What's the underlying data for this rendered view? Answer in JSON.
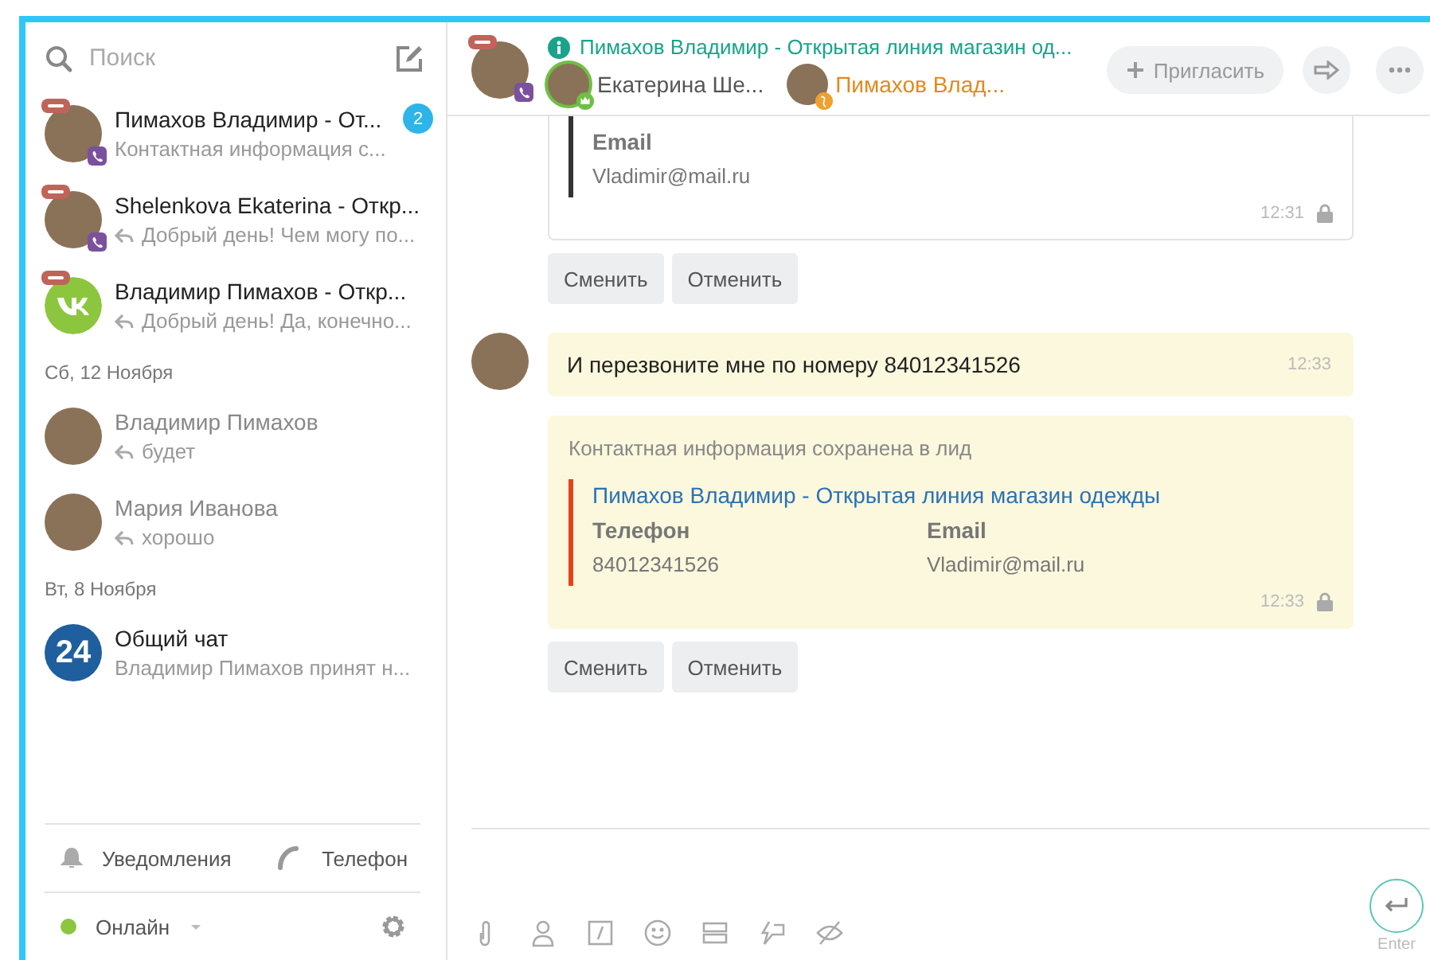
{
  "sidebar": {
    "search": {
      "placeholder": "Поиск"
    },
    "items": [
      {
        "kind": "chat",
        "avatar": {
          "kind": "photo"
        },
        "crm": true,
        "viber": true,
        "name": "Пимахов Владимир - От...",
        "preview": "Контактная информация с...",
        "reply": false,
        "dimmed": false,
        "unread": "2"
      },
      {
        "kind": "chat",
        "avatar": {
          "kind": "photo"
        },
        "crm": true,
        "viber": true,
        "name": "Shelenkova Ekaterina - Откр...",
        "preview": "Добрый день! Чем могу по...",
        "reply": true,
        "dimmed": false
      },
      {
        "kind": "chat",
        "avatar": {
          "kind": "vk"
        },
        "crm": true,
        "viber": false,
        "name": "Владимир Пимахов - Откр...",
        "preview": "Добрый день! Да, конечно...",
        "reply": true,
        "dimmed": false
      },
      {
        "kind": "date",
        "label": "Сб, 12 Ноября"
      },
      {
        "kind": "chat",
        "avatar": {
          "kind": "photo"
        },
        "crm": false,
        "viber": false,
        "name": "Владимир Пимахов",
        "preview": "будет",
        "reply": true,
        "dimmed": true
      },
      {
        "kind": "chat",
        "avatar": {
          "kind": "photo"
        },
        "crm": false,
        "viber": false,
        "name": "Мария Иванова",
        "preview": "хорошо",
        "reply": true,
        "dimmed": true
      },
      {
        "kind": "date",
        "label": "Вт, 8 Ноября"
      },
      {
        "kind": "chat",
        "avatar": {
          "kind": "b24",
          "text": "24"
        },
        "crm": false,
        "viber": false,
        "name": "Общий чат",
        "preview": "Владимир Пимахов принят н...",
        "reply": false,
        "dimmed": false
      }
    ],
    "footer": {
      "notifications": "Уведомления",
      "phone": "Телефон",
      "status": "Онлайн",
      "status_dot": {
        "color": "#8cc63f"
      }
    }
  },
  "header": {
    "crm": true,
    "title": "Пимахов Владимир - Открытая линия магазин од...",
    "participants": [
      {
        "name": "Екатерина Ше...",
        "color": "#555555",
        "badge": {
          "kind": "crown"
        }
      },
      {
        "name": "Пимахов Влад...",
        "color": "#e08a1e",
        "badge": {
          "kind": "globe"
        }
      }
    ],
    "invite": "Пригласить"
  },
  "messages": [
    {
      "kind": "card",
      "color": "#333333",
      "fields": [
        {
          "label": "Email",
          "value": "Vladimir@mail.ru"
        }
      ],
      "time": "12:31",
      "locked": true
    },
    {
      "kind": "actions",
      "buttons": [
        "Сменить",
        "Отменить"
      ]
    },
    {
      "kind": "text",
      "avatar": true,
      "text": "И перезвоните мне по номеру 84012341526",
      "time": "12:33"
    },
    {
      "kind": "card",
      "notice": "Контактная информация сохранена в лид",
      "color": "#e8411d",
      "link": "Пимахов Владимир - Открытая линия магазин одежды",
      "fields": [
        {
          "label": "Телефон",
          "value": "84012341526"
        },
        {
          "label": "Email",
          "value": "Vladimir@mail.ru"
        }
      ],
      "time": "12:33",
      "locked": true
    },
    {
      "kind": "actions",
      "buttons": [
        "Сменить",
        "Отменить"
      ]
    }
  ],
  "composer": {
    "send_hint": "Enter"
  }
}
